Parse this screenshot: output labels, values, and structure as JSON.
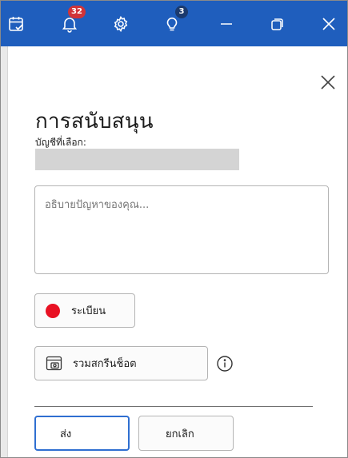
{
  "titlebar": {
    "notifications_count": "32",
    "tips_count": "3",
    "accent_color": "#1f5ebd",
    "icons": [
      "calendar-check-icon",
      "bell-icon",
      "gear-icon",
      "lightbulb-icon",
      "minimize-icon",
      "restore-icon",
      "close-icon"
    ]
  },
  "support": {
    "title": "การสนับสนุน",
    "account_label": "บัญชีที่เลือก:",
    "description_placeholder": "อธิบายปัญหาของคุณ...",
    "record_label": "ระเบียน",
    "screenshot_label": "รวมสกรีนช็อต",
    "send_label": "ส่ง",
    "cancel_label": "ยกเลิก",
    "record_color": "#e81123"
  }
}
